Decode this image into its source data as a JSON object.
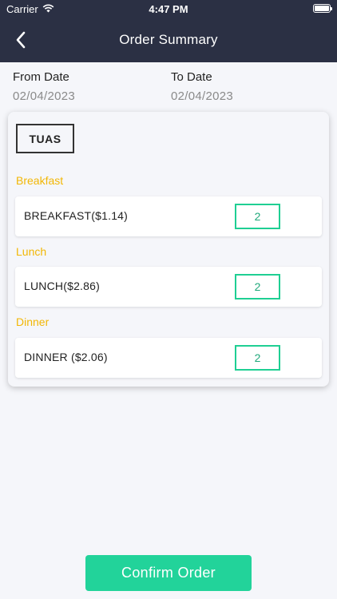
{
  "status_bar": {
    "carrier": "Carrier",
    "time": "4:47 PM"
  },
  "nav": {
    "title": "Order Summary"
  },
  "dates": {
    "from_label": "From Date",
    "from_value": "02/04/2023",
    "to_label": "To Date",
    "to_value": "02/04/2023"
  },
  "location": "TUAS",
  "meals": [
    {
      "heading": "Breakfast",
      "label": "BREAKFAST($1.14)",
      "quantity": "2"
    },
    {
      "heading": "Lunch",
      "label": "LUNCH($2.86)",
      "quantity": "2"
    },
    {
      "heading": "Dinner",
      "label": "DINNER ($2.06)",
      "quantity": "2"
    }
  ],
  "confirm_label": "Confirm Order",
  "colors": {
    "nav_bg": "#2b3044",
    "accent_yellow": "#f2b705",
    "accent_green": "#22d39a"
  }
}
